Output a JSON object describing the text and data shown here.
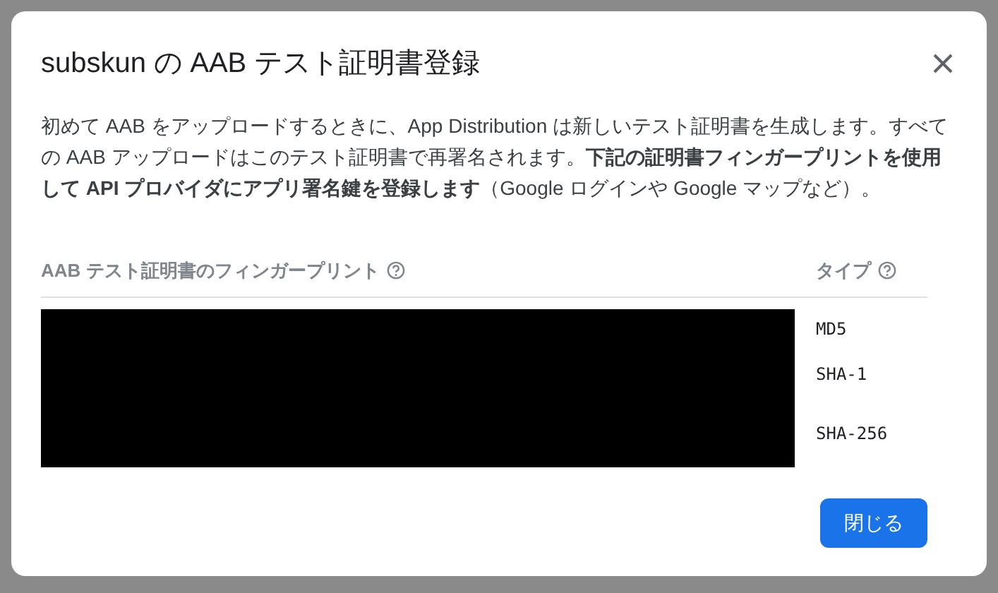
{
  "dialog": {
    "title": "subskun の AAB テスト証明書登録",
    "description": "初めて AAB をアップロードするときに、App Distribution は新しいテスト証明書を生成します。すべての AAB アップロードはこのテスト証明書で再署名されます。**下記の証明書フィンガープリントを使用して API プロバイダにアプリ署名鍵を登録します**（Google ログインや Google マップなど）。",
    "table": {
      "columns": [
        "AAB テスト証明書のフィンガープリント",
        "タイプ"
      ],
      "rows": [
        {
          "type": "MD5"
        },
        {
          "type": "SHA-1"
        },
        {
          "type": "SHA-256"
        }
      ]
    },
    "buttons": [
      "閉じる"
    ]
  }
}
